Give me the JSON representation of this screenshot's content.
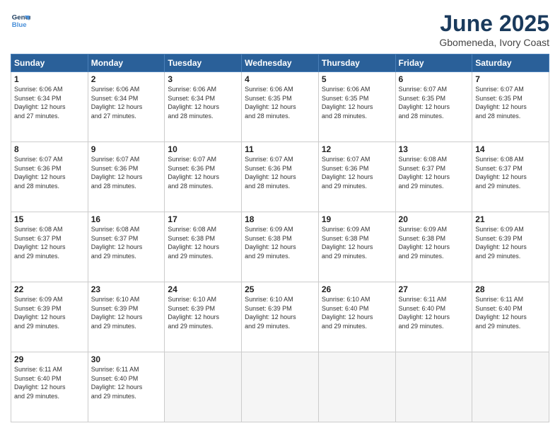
{
  "logo": {
    "line1": "General",
    "line2": "Blue"
  },
  "title": "June 2025",
  "subtitle": "Gbomeneda, Ivory Coast",
  "headers": [
    "Sunday",
    "Monday",
    "Tuesday",
    "Wednesday",
    "Thursday",
    "Friday",
    "Saturday"
  ],
  "weeks": [
    [
      {
        "day": "1",
        "sunrise": "6:06 AM",
        "sunset": "6:34 PM",
        "daylight": "12 hours and 27 minutes."
      },
      {
        "day": "2",
        "sunrise": "6:06 AM",
        "sunset": "6:34 PM",
        "daylight": "12 hours and 27 minutes."
      },
      {
        "day": "3",
        "sunrise": "6:06 AM",
        "sunset": "6:34 PM",
        "daylight": "12 hours and 28 minutes."
      },
      {
        "day": "4",
        "sunrise": "6:06 AM",
        "sunset": "6:35 PM",
        "daylight": "12 hours and 28 minutes."
      },
      {
        "day": "5",
        "sunrise": "6:06 AM",
        "sunset": "6:35 PM",
        "daylight": "12 hours and 28 minutes."
      },
      {
        "day": "6",
        "sunrise": "6:07 AM",
        "sunset": "6:35 PM",
        "daylight": "12 hours and 28 minutes."
      },
      {
        "day": "7",
        "sunrise": "6:07 AM",
        "sunset": "6:35 PM",
        "daylight": "12 hours and 28 minutes."
      }
    ],
    [
      {
        "day": "8",
        "sunrise": "6:07 AM",
        "sunset": "6:36 PM",
        "daylight": "12 hours and 28 minutes."
      },
      {
        "day": "9",
        "sunrise": "6:07 AM",
        "sunset": "6:36 PM",
        "daylight": "12 hours and 28 minutes."
      },
      {
        "day": "10",
        "sunrise": "6:07 AM",
        "sunset": "6:36 PM",
        "daylight": "12 hours and 28 minutes."
      },
      {
        "day": "11",
        "sunrise": "6:07 AM",
        "sunset": "6:36 PM",
        "daylight": "12 hours and 28 minutes."
      },
      {
        "day": "12",
        "sunrise": "6:07 AM",
        "sunset": "6:36 PM",
        "daylight": "12 hours and 29 minutes."
      },
      {
        "day": "13",
        "sunrise": "6:08 AM",
        "sunset": "6:37 PM",
        "daylight": "12 hours and 29 minutes."
      },
      {
        "day": "14",
        "sunrise": "6:08 AM",
        "sunset": "6:37 PM",
        "daylight": "12 hours and 29 minutes."
      }
    ],
    [
      {
        "day": "15",
        "sunrise": "6:08 AM",
        "sunset": "6:37 PM",
        "daylight": "12 hours and 29 minutes."
      },
      {
        "day": "16",
        "sunrise": "6:08 AM",
        "sunset": "6:37 PM",
        "daylight": "12 hours and 29 minutes."
      },
      {
        "day": "17",
        "sunrise": "6:08 AM",
        "sunset": "6:38 PM",
        "daylight": "12 hours and 29 minutes."
      },
      {
        "day": "18",
        "sunrise": "6:09 AM",
        "sunset": "6:38 PM",
        "daylight": "12 hours and 29 minutes."
      },
      {
        "day": "19",
        "sunrise": "6:09 AM",
        "sunset": "6:38 PM",
        "daylight": "12 hours and 29 minutes."
      },
      {
        "day": "20",
        "sunrise": "6:09 AM",
        "sunset": "6:38 PM",
        "daylight": "12 hours and 29 minutes."
      },
      {
        "day": "21",
        "sunrise": "6:09 AM",
        "sunset": "6:39 PM",
        "daylight": "12 hours and 29 minutes."
      }
    ],
    [
      {
        "day": "22",
        "sunrise": "6:09 AM",
        "sunset": "6:39 PM",
        "daylight": "12 hours and 29 minutes."
      },
      {
        "day": "23",
        "sunrise": "6:10 AM",
        "sunset": "6:39 PM",
        "daylight": "12 hours and 29 minutes."
      },
      {
        "day": "24",
        "sunrise": "6:10 AM",
        "sunset": "6:39 PM",
        "daylight": "12 hours and 29 minutes."
      },
      {
        "day": "25",
        "sunrise": "6:10 AM",
        "sunset": "6:39 PM",
        "daylight": "12 hours and 29 minutes."
      },
      {
        "day": "26",
        "sunrise": "6:10 AM",
        "sunset": "6:40 PM",
        "daylight": "12 hours and 29 minutes."
      },
      {
        "day": "27",
        "sunrise": "6:11 AM",
        "sunset": "6:40 PM",
        "daylight": "12 hours and 29 minutes."
      },
      {
        "day": "28",
        "sunrise": "6:11 AM",
        "sunset": "6:40 PM",
        "daylight": "12 hours and 29 minutes."
      }
    ],
    [
      {
        "day": "29",
        "sunrise": "6:11 AM",
        "sunset": "6:40 PM",
        "daylight": "12 hours and 29 minutes."
      },
      {
        "day": "30",
        "sunrise": "6:11 AM",
        "sunset": "6:40 PM",
        "daylight": "12 hours and 29 minutes."
      },
      null,
      null,
      null,
      null,
      null
    ]
  ],
  "labels": {
    "sunrise": "Sunrise:",
    "sunset": "Sunset:",
    "daylight": "Daylight:"
  }
}
